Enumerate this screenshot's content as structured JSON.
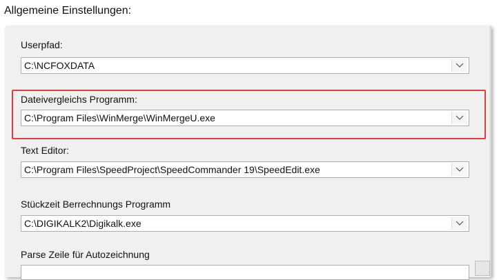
{
  "title": "Allgemeine Einstellungen:",
  "fields": [
    {
      "label": "Userpfad:",
      "value": "C:\\NCFOXDATA"
    },
    {
      "label": "Dateivergleichs Programm:",
      "value": "C:\\Program Files\\WinMerge\\WinMergeU.exe"
    },
    {
      "label": "Text Editor:",
      "value": "C:\\Program Files\\SpeedProject\\SpeedCommander 19\\SpeedEdit.exe"
    },
    {
      "label": "Stückzeit Berrechnungs Programm",
      "value": "C:\\DIGIKALK2\\Digikalk.exe"
    },
    {
      "label": "Parse Zeile für Autozeichnung",
      "value": ""
    }
  ],
  "icons": {
    "dropdown": "chevron-down-icon"
  },
  "colors": {
    "highlight": "#e53a3a",
    "panel": "#f0f0f0"
  }
}
